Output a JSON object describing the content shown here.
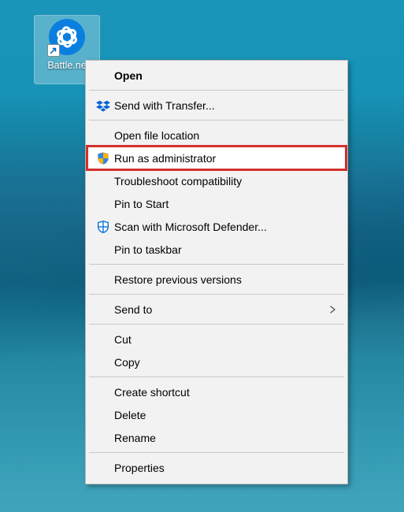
{
  "desktop_icon": {
    "label": "Battle.ne",
    "app_name": "Battle.net",
    "shortcut_arrow": "↗"
  },
  "context_menu": {
    "open": "Open",
    "send_with_transfer": "Send with Transfer...",
    "open_file_location": "Open file location",
    "run_as_admin": "Run as administrator",
    "troubleshoot": "Troubleshoot compatibility",
    "pin_to_start": "Pin to Start",
    "scan_defender": "Scan with Microsoft Defender...",
    "pin_to_taskbar": "Pin to taskbar",
    "restore_versions": "Restore previous versions",
    "send_to": "Send to",
    "cut": "Cut",
    "copy": "Copy",
    "create_shortcut": "Create shortcut",
    "delete": "Delete",
    "rename": "Rename",
    "properties": "Properties"
  },
  "highlighted_item_key": "run_as_admin"
}
